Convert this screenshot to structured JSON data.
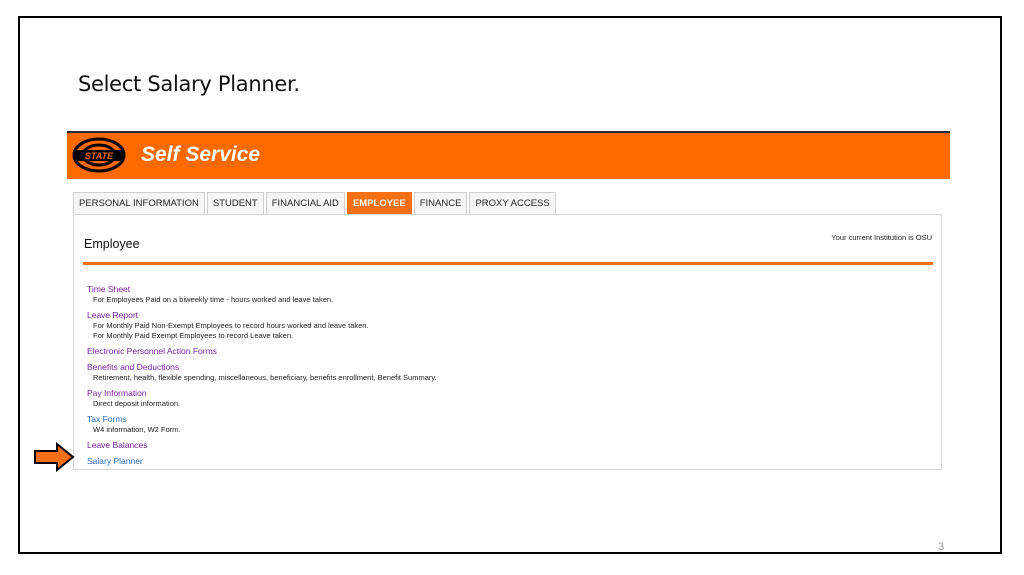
{
  "slide": {
    "title": "Select Salary Planner.",
    "page_number": "3"
  },
  "banner": {
    "title": "Self Service",
    "logo_icon": "osu-state-logo-icon",
    "color": "#fe6a00"
  },
  "tabs": [
    {
      "label": "PERSONAL INFORMATION",
      "active": false
    },
    {
      "label": "STUDENT",
      "active": false
    },
    {
      "label": "FINANCIAL AID",
      "active": false
    },
    {
      "label": "EMPLOYEE",
      "active": true
    },
    {
      "label": "FINANCE",
      "active": false
    },
    {
      "label": "PROXY ACCESS",
      "active": false
    }
  ],
  "panel": {
    "title": "Employee",
    "institution": "Your current Institution is OSU"
  },
  "menu": {
    "time_sheet": {
      "label": "Time Sheet",
      "desc": "For Employees Paid on a biweekly time - hours worked and leave taken."
    },
    "leave_report": {
      "label": "Leave Report",
      "desc1": "For Monthly Paid Non-Exempt Employees to record hours worked and leave taken.",
      "desc2": "For Monthly Paid Exempt Employees to record Leave taken."
    },
    "epaf": {
      "label": "Electronic Personnel Action Forms"
    },
    "benefits": {
      "label": "Benefits and Deductions",
      "desc": "Retirement, health, flexible spending, miscellaneous, beneficiary, benefits enrollment, Benefit Summary."
    },
    "pay_info": {
      "label": "Pay Information",
      "desc": "Direct deposit information."
    },
    "tax_forms": {
      "label": "Tax Forms",
      "desc": "W4 information, W2 Form."
    },
    "leave_balances": {
      "label": "Leave Balances"
    },
    "salary_planner": {
      "label": "Salary Planner"
    }
  },
  "pointer": {
    "icon": "right-arrow-icon",
    "color": "#f56f15"
  }
}
